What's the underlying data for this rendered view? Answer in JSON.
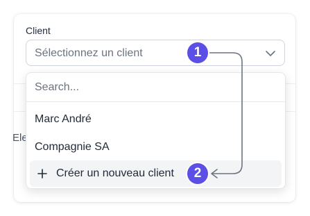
{
  "field": {
    "label": "Client",
    "placeholder": "Sélectionnez un client"
  },
  "background": {
    "partial_text": "Ele"
  },
  "dropdown": {
    "search_placeholder": "Search...",
    "options": [
      {
        "label": "Marc André"
      },
      {
        "label": "Compagnie SA"
      }
    ],
    "create_label": "Créer un nouveau client"
  },
  "annotations": {
    "step1": "1",
    "step2": "2",
    "color": "#5b4fe6"
  },
  "icons": {
    "chevron": "chevron-down-icon",
    "plus": "plus-icon"
  }
}
